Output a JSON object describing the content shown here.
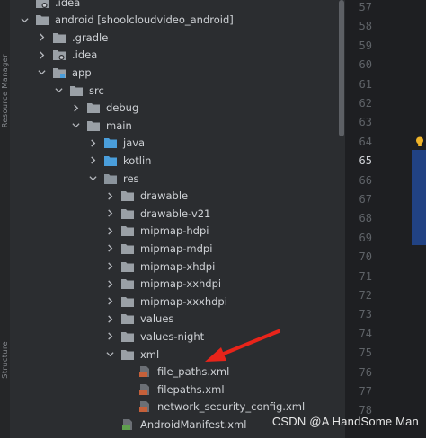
{
  "side_tabs": [
    "Resource Manager",
    "Structure"
  ],
  "tree": {
    "rows": [
      {
        "label": ".idea",
        "depth": 1,
        "icon": "folder-settings-icon",
        "chevron": "none"
      },
      {
        "label": "android [shoolcloudvideo_android]",
        "depth": 1,
        "icon": "folder-icon",
        "chevron": "down"
      },
      {
        "label": ".gradle",
        "depth": 2,
        "icon": "folder-icon",
        "chevron": "right"
      },
      {
        "label": ".idea",
        "depth": 2,
        "icon": "folder-settings-icon",
        "chevron": "right"
      },
      {
        "label": "app",
        "depth": 2,
        "icon": "module-folder-icon",
        "chevron": "down"
      },
      {
        "label": "src",
        "depth": 3,
        "icon": "folder-icon",
        "chevron": "down"
      },
      {
        "label": "debug",
        "depth": 4,
        "icon": "folder-icon",
        "chevron": "right"
      },
      {
        "label": "main",
        "depth": 4,
        "icon": "folder-icon",
        "chevron": "down"
      },
      {
        "label": "java",
        "depth": 5,
        "icon": "source-folder-icon",
        "chevron": "right"
      },
      {
        "label": "kotlin",
        "depth": 5,
        "icon": "source-folder-icon",
        "chevron": "right"
      },
      {
        "label": "res",
        "depth": 5,
        "icon": "resource-folder-icon",
        "chevron": "down"
      },
      {
        "label": "drawable",
        "depth": 6,
        "icon": "folder-icon",
        "chevron": "right"
      },
      {
        "label": "drawable-v21",
        "depth": 6,
        "icon": "folder-icon",
        "chevron": "right"
      },
      {
        "label": "mipmap-hdpi",
        "depth": 6,
        "icon": "folder-icon",
        "chevron": "right"
      },
      {
        "label": "mipmap-mdpi",
        "depth": 6,
        "icon": "folder-icon",
        "chevron": "right"
      },
      {
        "label": "mipmap-xhdpi",
        "depth": 6,
        "icon": "folder-icon",
        "chevron": "right"
      },
      {
        "label": "mipmap-xxhdpi",
        "depth": 6,
        "icon": "folder-icon",
        "chevron": "right"
      },
      {
        "label": "mipmap-xxxhdpi",
        "depth": 6,
        "icon": "folder-icon",
        "chevron": "right"
      },
      {
        "label": "values",
        "depth": 6,
        "icon": "folder-icon",
        "chevron": "right"
      },
      {
        "label": "values-night",
        "depth": 6,
        "icon": "folder-icon",
        "chevron": "right"
      },
      {
        "label": "xml",
        "depth": 6,
        "icon": "folder-icon",
        "chevron": "down"
      },
      {
        "label": "file_paths.xml",
        "depth": 7,
        "icon": "xml-file-icon",
        "chevron": "none"
      },
      {
        "label": "filepaths.xml",
        "depth": 7,
        "icon": "xml-file-icon",
        "chevron": "none"
      },
      {
        "label": "network_security_config.xml",
        "depth": 7,
        "icon": "xml-file-icon",
        "chevron": "none"
      },
      {
        "label": "AndroidManifest.xml",
        "depth": 6,
        "icon": "manifest-file-icon",
        "chevron": "none"
      }
    ]
  },
  "gutter": {
    "line_numbers": [
      "57",
      "58",
      "59",
      "60",
      "61",
      "62",
      "63",
      "64",
      "65",
      "66",
      "67",
      "68",
      "69",
      "70",
      "71",
      "72",
      "73",
      "74",
      "75",
      "76",
      "77",
      "78"
    ],
    "active_line": "65"
  },
  "annotation": {
    "type": "red-arrow",
    "points_to": "file_paths.xml"
  },
  "watermark": "CSDN @A HandSome Man",
  "colors": {
    "panel_bg": "#2b2d30",
    "editor_bg": "#1e1f22",
    "folder": "#9aa0a6",
    "source_folder": "#4a9edb",
    "xml_icon": "#c5603a",
    "selection": "#214283",
    "arrow": "#e8241a"
  }
}
